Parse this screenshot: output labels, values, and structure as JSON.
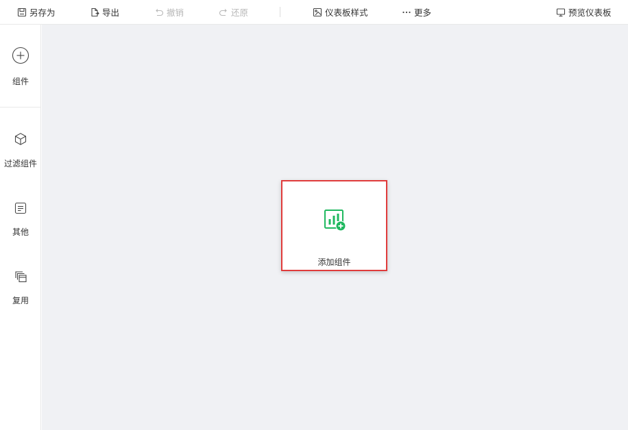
{
  "toolbar": {
    "save_as": "另存为",
    "export": "导出",
    "undo": "撤销",
    "redo": "还原",
    "dashboard_style": "仪表板样式",
    "more": "更多",
    "preview": "预览仪表板"
  },
  "sidebar": {
    "items": [
      {
        "label": "组件",
        "icon": "plus-circle-icon"
      },
      {
        "label": "过滤组件",
        "icon": "cube-icon"
      },
      {
        "label": "其他",
        "icon": "document-icon"
      },
      {
        "label": "复用",
        "icon": "layers-icon"
      }
    ]
  },
  "canvas": {
    "add_component_label": "添加组件",
    "card_border_color": "#e03a3a",
    "accent_color": "#1fb85f"
  },
  "colors": {
    "canvas_bg": "#f0f1f4",
    "disabled_text": "#b8b8b8"
  }
}
